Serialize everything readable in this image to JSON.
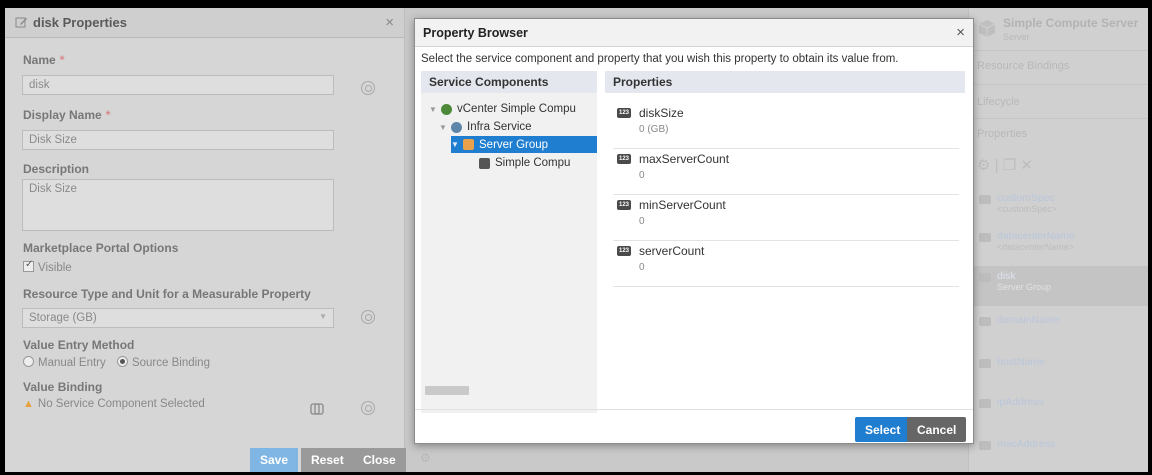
{
  "disk_panel": {
    "title": "disk Properties",
    "name_label": "Name",
    "name_value": "disk",
    "display_name_label": "Display Name",
    "display_name_value": "Disk Size",
    "description_label": "Description",
    "description_value": "Disk Size",
    "marketplace_label": "Marketplace Portal Options",
    "visible_label": "Visible",
    "resource_label": "Resource Type and Unit for a Measurable Property",
    "resource_value": "Storage (GB)",
    "value_entry_label": "Value Entry Method",
    "manual_entry": "Manual Entry",
    "source_binding": "Source Binding",
    "value_binding_label": "Value Binding",
    "value_binding_value": "No Service Component Selected",
    "required_mark": "*",
    "save": "Save",
    "reset": "Reset",
    "close": "Close"
  },
  "modal": {
    "title": "Property Browser",
    "instruction": "Select the service component and property that you wish this property to obtain its value from.",
    "sc_header": "Service Components",
    "props_header": "Properties",
    "tree": [
      {
        "label": "vCenter Simple Compu",
        "selected": false
      },
      {
        "label": "Infra Service",
        "selected": false
      },
      {
        "label": "Server Group",
        "selected": true
      },
      {
        "label": "Simple Compu",
        "selected": false
      }
    ],
    "properties": [
      {
        "name": "diskSize",
        "value": "0 (GB)"
      },
      {
        "name": "maxServerCount",
        "value": "0"
      },
      {
        "name": "minServerCount",
        "value": "0"
      },
      {
        "name": "serverCount",
        "value": "0"
      }
    ],
    "select": "Select",
    "cancel": "Cancel"
  },
  "right_panel": {
    "title": "Simple Compute Server",
    "subtitle": "Server",
    "resource_bindings": "Resource Bindings",
    "lifecycle": "Lifecycle",
    "properties": "Properties",
    "items": [
      {
        "name": "customSpec",
        "sub": "<customSpec>"
      },
      {
        "name": "datacenterName",
        "sub": "<datacenterName>"
      },
      {
        "name": "disk",
        "sub": "Server Group"
      },
      {
        "name": "domainName",
        "sub": ""
      },
      {
        "name": "hostName",
        "sub": ""
      },
      {
        "name": "ipAddress",
        "sub": ""
      },
      {
        "name": "macAddress",
        "sub": ""
      }
    ]
  },
  "colors": {
    "accent": "#1f7ed0",
    "cancel": "#666666",
    "warn": "#e6a23c"
  },
  "icons": [
    "edit-icon",
    "close-icon",
    "help-icon",
    "warning-icon",
    "binding-icon",
    "tree-arrow-icon",
    "component-icon",
    "number-badge-icon",
    "gear-icon",
    "cube-icon"
  ]
}
